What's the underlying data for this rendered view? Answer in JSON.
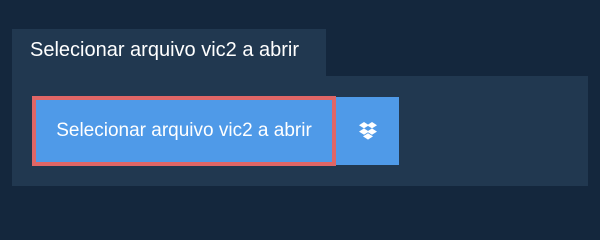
{
  "tab": {
    "label": "Selecionar arquivo vic2 a abrir"
  },
  "panel": {
    "select_button_label": "Selecionar arquivo vic2 a abrir",
    "dropbox_icon": "dropbox-icon"
  },
  "colors": {
    "background": "#14273d",
    "panel": "#213850",
    "button": "#4f9ae8",
    "focus_border": "#e06666",
    "text": "#ffffff"
  }
}
